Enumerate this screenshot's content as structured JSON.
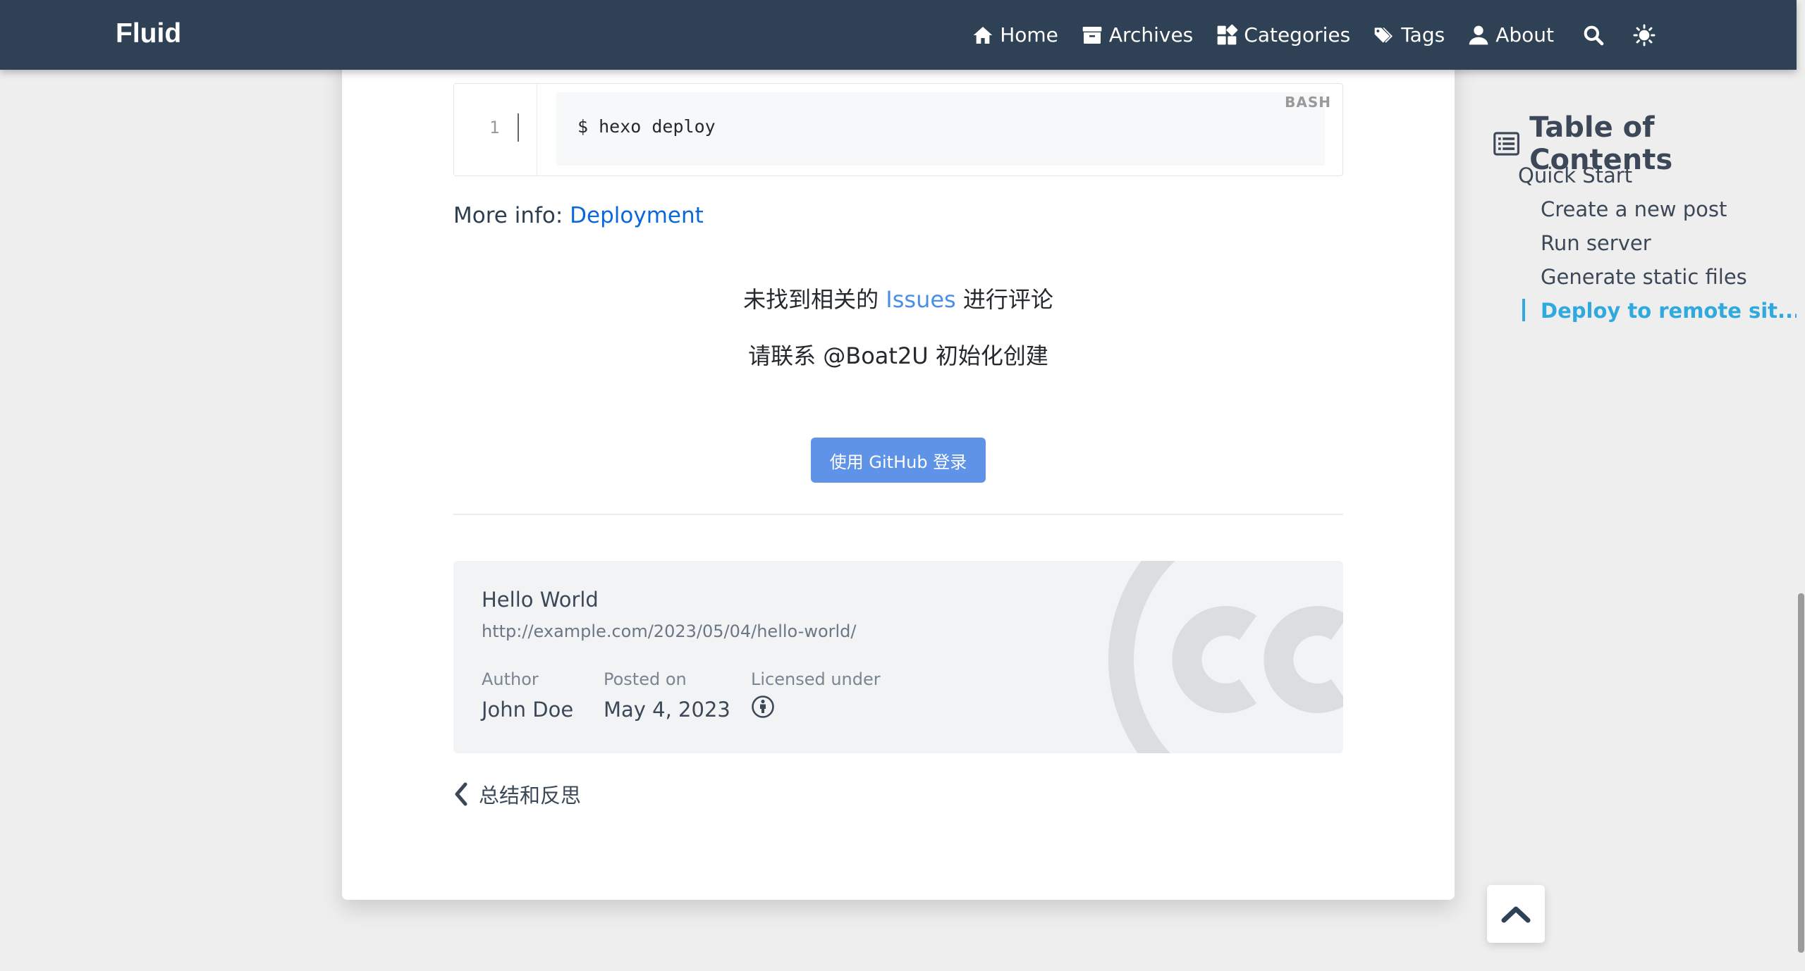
{
  "navbar": {
    "brand": "Fluid",
    "items": [
      {
        "label": "Home",
        "icon": "home-icon"
      },
      {
        "label": "Archives",
        "icon": "archive-icon"
      },
      {
        "label": "Categories",
        "icon": "categories-icon"
      },
      {
        "label": "Tags",
        "icon": "tags-icon"
      },
      {
        "label": "About",
        "icon": "user-icon"
      }
    ],
    "search_icon": "search-icon",
    "theme_icon": "sun-icon"
  },
  "post": {
    "code": {
      "line_number": "1",
      "text": "$ hexo deploy",
      "language": "BASH"
    },
    "more_info": {
      "prefix": "More info: ",
      "link_text": "Deployment"
    },
    "comments": {
      "line1_before": "未找到相关的 ",
      "issues_link": "Issues",
      "line1_after": " 进行评论",
      "line2": "请联系 @Boat2U 初始化创建",
      "login_button": "使用 GitHub 登录"
    },
    "license": {
      "title": "Hello World",
      "url": "http://example.com/2023/05/04/hello-world/",
      "author_label": "Author",
      "author": "John Doe",
      "posted_label": "Posted on",
      "posted": "May 4, 2023",
      "licensed_label": "Licensed under",
      "license_icon": "cc-by-icon"
    },
    "prev_post": {
      "label": "总结和反思"
    }
  },
  "toc": {
    "title": "Table of Contents",
    "items": [
      {
        "label": "Quick Start",
        "level": 1
      },
      {
        "label": "Create a new post",
        "level": 2
      },
      {
        "label": "Run server",
        "level": 2
      },
      {
        "label": "Generate static files",
        "level": 2
      },
      {
        "label": "Deploy to remote sit...",
        "level": 2,
        "active": true
      }
    ],
    "active_color": "#30a9de"
  },
  "colors": {
    "navbar": "#2f4154",
    "link": "#0969da",
    "button": "#5f93e8",
    "accent": "#30a9de"
  }
}
